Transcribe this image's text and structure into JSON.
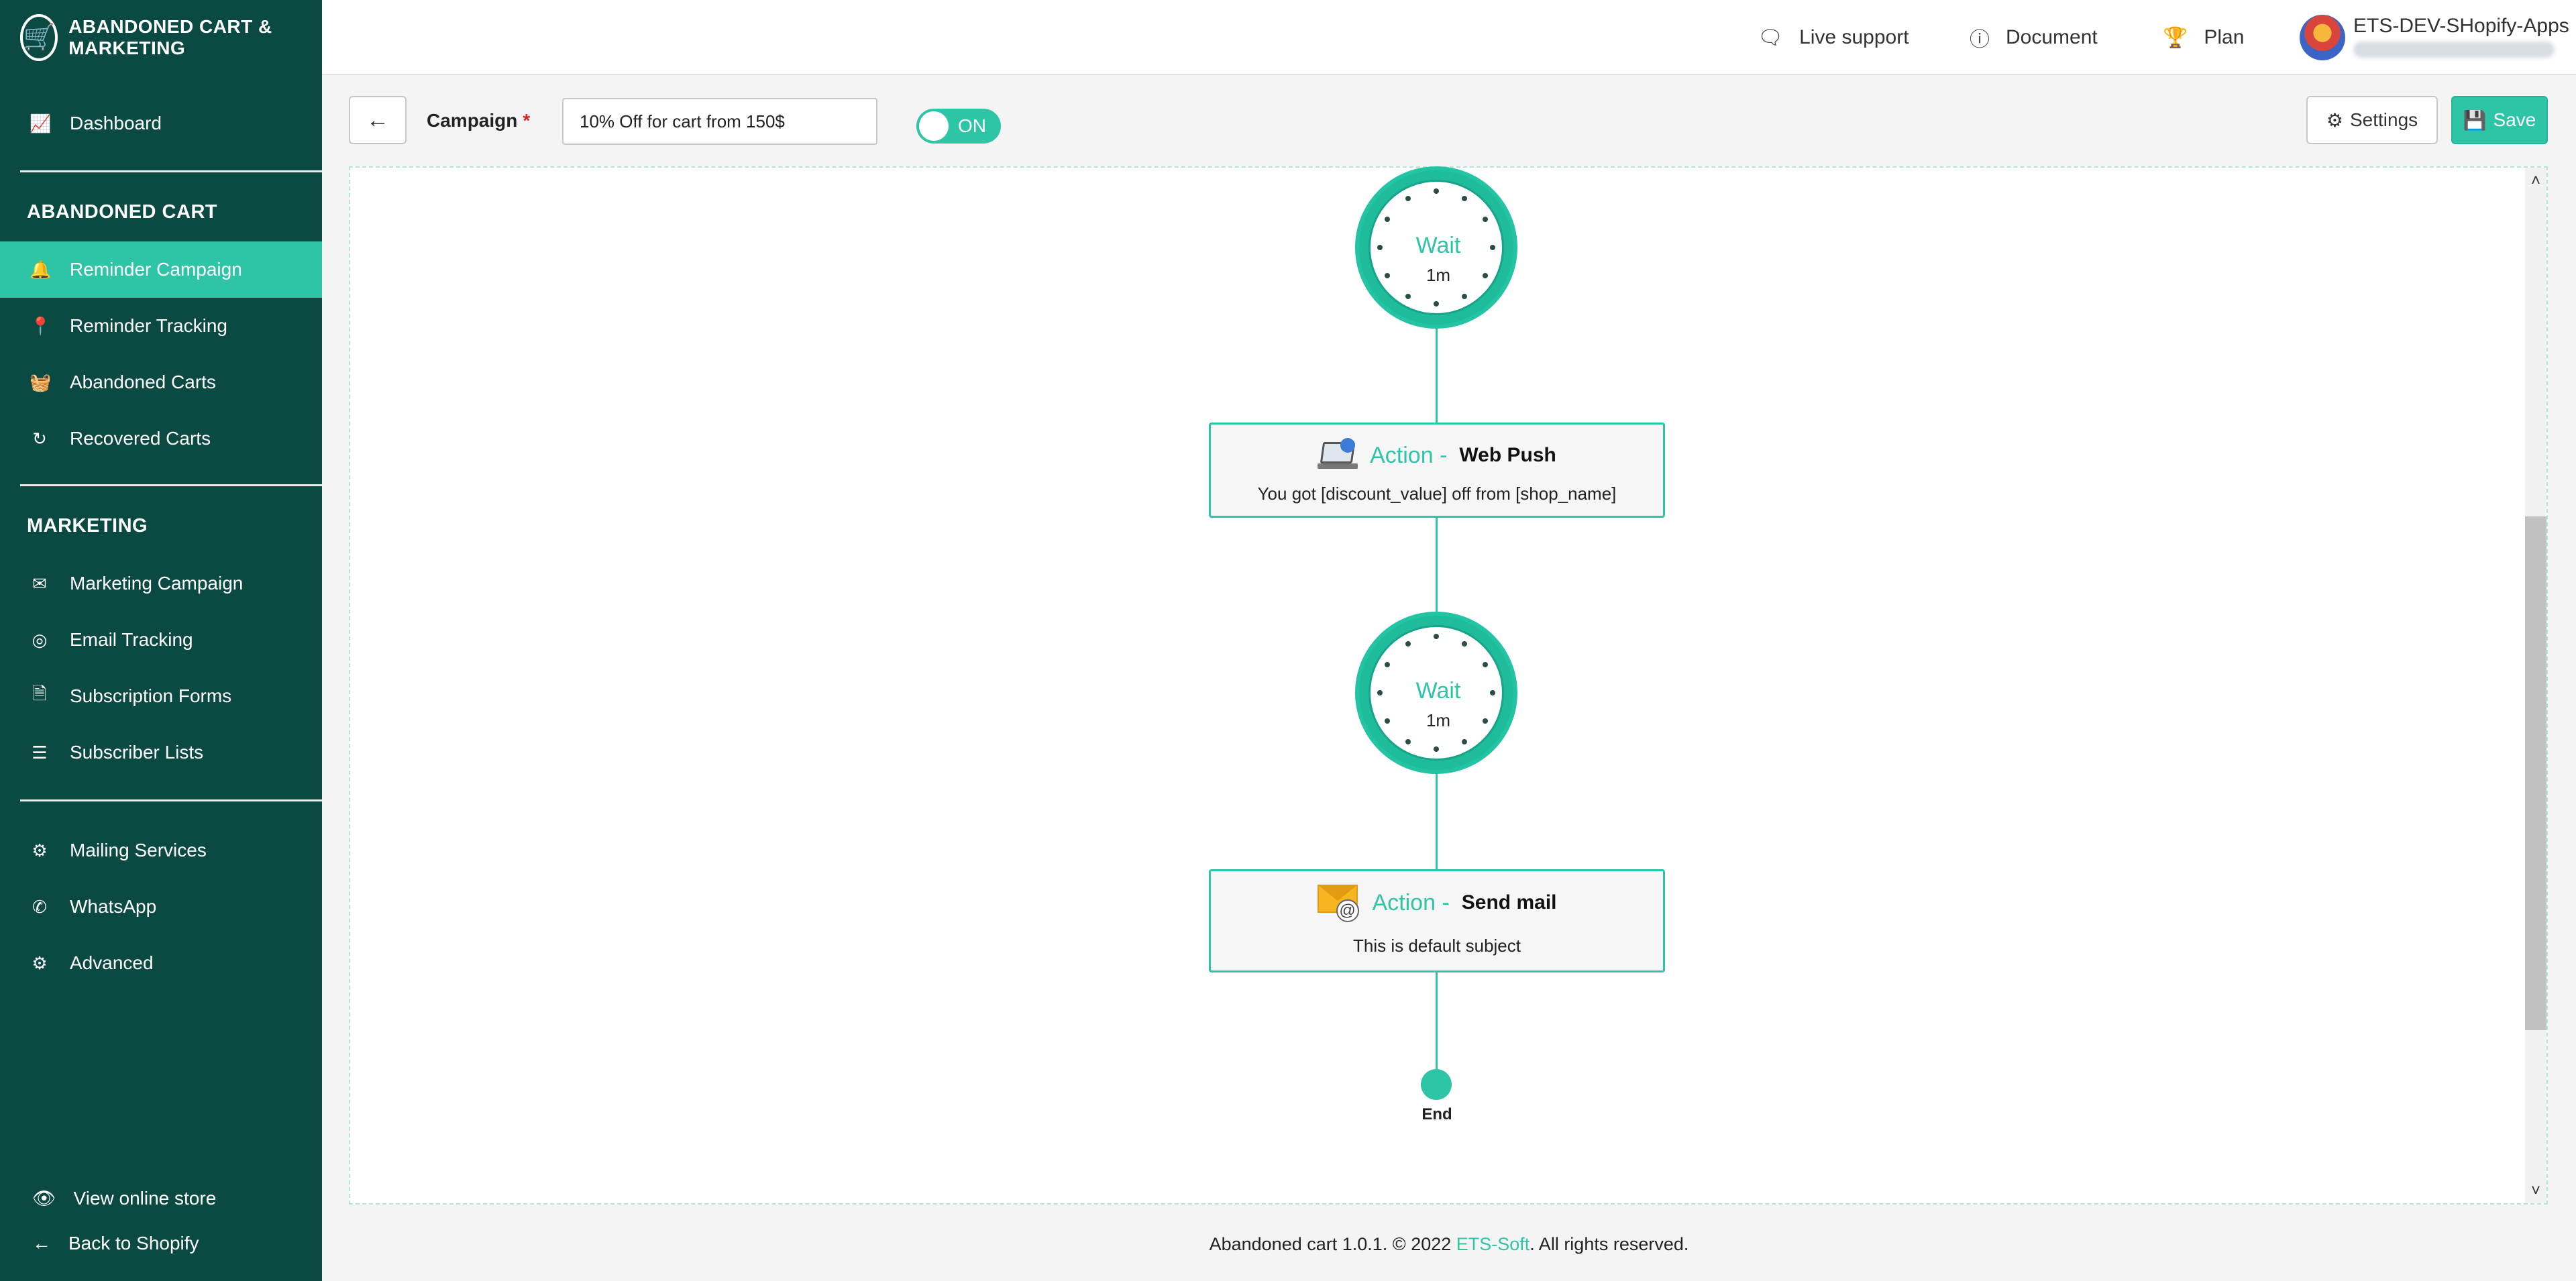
{
  "app": {
    "brand": "Abandoned Cart & Marketing"
  },
  "sidebar": {
    "dashboard": {
      "label": "Dashboard",
      "icon": "chart-line-icon"
    },
    "section_abandoned": "ABANDONED CART",
    "abandoned_items": [
      {
        "label": "Reminder Campaign",
        "icon": "bell-icon",
        "active": true
      },
      {
        "label": "Reminder Tracking",
        "icon": "map-pin-icon"
      },
      {
        "label": "Abandoned Carts",
        "icon": "basket-icon"
      },
      {
        "label": "Recovered Carts",
        "icon": "refresh-icon"
      }
    ],
    "section_marketing": "MARKETING",
    "marketing_items": [
      {
        "label": "Marketing Campaign",
        "icon": "envelope-icon"
      },
      {
        "label": "Email Tracking",
        "icon": "target-icon"
      },
      {
        "label": "Subscription Forms",
        "icon": "document-icon"
      },
      {
        "label": "Subscriber Lists",
        "icon": "list-icon"
      }
    ],
    "other_items": [
      {
        "label": "Mailing Services",
        "icon": "gear-icon"
      },
      {
        "label": "WhatsApp",
        "icon": "whatsapp-icon"
      },
      {
        "label": "Advanced",
        "icon": "gears-icon"
      }
    ],
    "view_store": "View online store",
    "back_shopify": "Back to Shopify"
  },
  "topbar": {
    "live_support": "Live support",
    "document": "Document",
    "plan": "Plan",
    "store_name": "ETS-DEV-SHopify-Apps"
  },
  "campaign": {
    "label": "Campaign",
    "required_mark": "*",
    "value": "10% Off for cart from 150$",
    "toggle_label": "ON",
    "settings": "Settings",
    "save": "Save"
  },
  "flow": {
    "wait1": {
      "label": "Wait",
      "value": "1m"
    },
    "action1": {
      "label": "Action",
      "sep": "-",
      "type": "Web Push",
      "desc": "You got [discount_value] off from [shop_name]"
    },
    "wait2": {
      "label": "Wait",
      "value": "1m"
    },
    "action2": {
      "label": "Action",
      "sep": "-",
      "type": "Send mail",
      "desc": "This is default subject"
    },
    "end": "End"
  },
  "footer": {
    "prefix": "Abandoned cart 1.0.1. © 2022 ",
    "brand": "ETS-Soft",
    "suffix": ". All rights reserved."
  },
  "colors": {
    "sidebar": "#0b4a43",
    "accent": "#2ec4a6",
    "required": "#d8232a"
  }
}
